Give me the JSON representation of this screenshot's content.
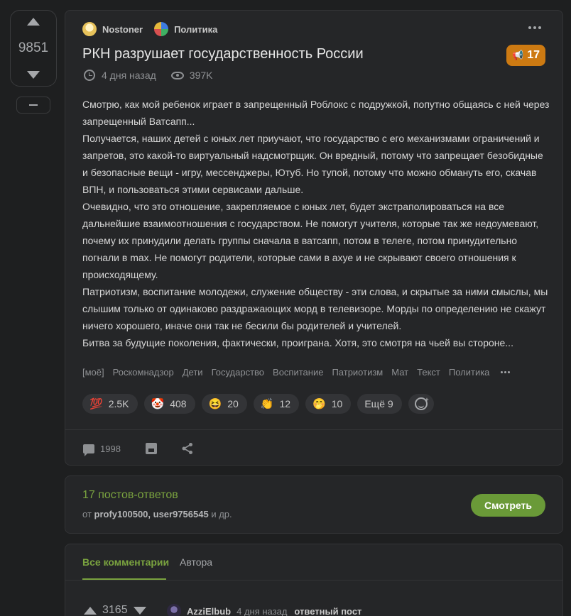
{
  "vote": {
    "count": "9851"
  },
  "post": {
    "author": "Nostoner",
    "community": "Политика",
    "title": "РКН разрушает государственность России",
    "rating": "17",
    "time": "4 дня назад",
    "views": "397K",
    "body": [
      "Смотрю, как мой ребенок играет в запрещенный Роблокс с подружкой, попутно общаясь с ней через запрещенный Ватсапп...",
      "Получается, наших детей с юных лет приучают, что государство с его механизмами ограничений и запретов, это какой-то виртуальный надсмотрщик. Он вредный, потому что запрещает безобидные и безопасные вещи - игру, мессенджеры, Ютуб. Но тупой, потому что можно обмануть его, скачав ВПН, и пользоваться этими сервисами дальше.",
      "Очевидно, что это отношение, закрепляемое с юных лет, будет экстраполироваться на все дальнейшие взаимоотношения с государством. Не помогут учителя, которые так же недоумевают, почему их принудили делать группы сначала в ватсапп, потом в телеге, потом принудительно погнали в max. Не помогут родители, которые сами в ахуе и не скрывают своего отношения к происходящему.",
      "Патриотизм, воспитание молодежи, служение обществу - эти слова, и скрытые за ними смыслы, мы слышим только от одинаково раздражающих морд в телевизоре. Морды по определению не скажут ничего хорошего, иначе они так не бесили бы родителей и учителей.",
      "Битва за будущие поколения, фактически, проиграна. Хотя, это смотря на чьей вы стороне..."
    ],
    "tags": [
      "[моё]",
      "Роскомнадзор",
      "Дети",
      "Государство",
      "Воспитание",
      "Патриотизм",
      "Мат",
      "Текст",
      "Политика"
    ],
    "reactions": [
      {
        "emoji": "💯",
        "count": "2.5K"
      },
      {
        "emoji": "🤡",
        "count": "408"
      },
      {
        "emoji": "😆",
        "count": "20"
      },
      {
        "emoji": "👏",
        "count": "12"
      },
      {
        "emoji": "🤭",
        "count": "10"
      }
    ],
    "reactions_more": "Ещё 9",
    "comments_count": "1998"
  },
  "answers": {
    "title": "17 постов-ответов",
    "from_prefix": "от",
    "from_users": "profy100500, user9756545",
    "from_suffix": "и др.",
    "button": "Смотреть"
  },
  "comments": {
    "tab_all": "Все комментарии",
    "tab_author": "Автора",
    "first": {
      "rating": "3165",
      "author": "AzziElbub",
      "time": "4 дня назад",
      "badge": "ответный пост"
    }
  },
  "colors": {
    "accent": "#7aa33f",
    "badge": "#cd7a12",
    "button": "#6a9a38",
    "background": "#1e1f20",
    "card": "#252628"
  }
}
